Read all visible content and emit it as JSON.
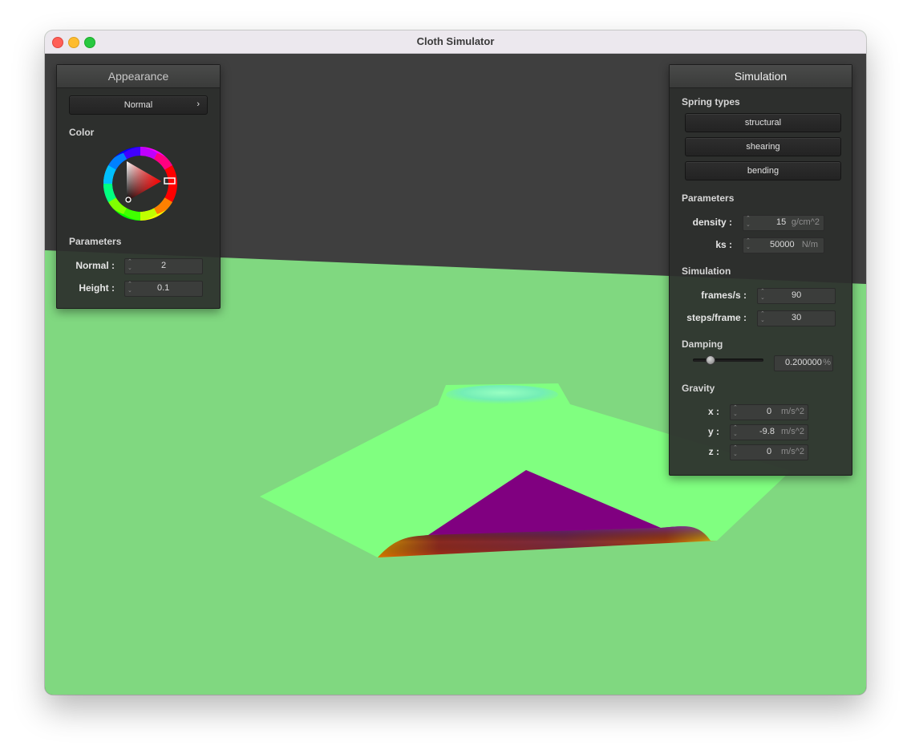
{
  "window": {
    "title": "Cloth Simulator"
  },
  "appearance": {
    "header": "Appearance",
    "shader_dropdown": {
      "value": "Normal",
      "chevron": "›"
    },
    "color_label": "Color",
    "params_label": "Parameters",
    "fields": [
      {
        "label": "Normal :",
        "value": "2"
      },
      {
        "label": "Height :",
        "value": "0.1"
      }
    ]
  },
  "simulation": {
    "header": "Simulation",
    "spring_types_label": "Spring types",
    "spring_buttons": [
      "structural",
      "shearing",
      "bending"
    ],
    "parameters_label": "Parameters",
    "density": {
      "label": "density :",
      "value": "15",
      "unit": "g/cm^2"
    },
    "ks": {
      "label": "ks :",
      "value": "50000",
      "unit": "N/m"
    },
    "simulation_label": "Simulation",
    "frames": {
      "label": "frames/s :",
      "value": "90"
    },
    "steps": {
      "label": "steps/frame :",
      "value": "30"
    },
    "damping_label": "Damping",
    "damping": {
      "value": "0.200000",
      "unit": "%",
      "slider_fraction": 0.2
    },
    "gravity_label": "Gravity",
    "gravity": [
      {
        "label": "x :",
        "value": "0",
        "unit": "m/s^2"
      },
      {
        "label": "y :",
        "value": "-9.8",
        "unit": "m/s^2"
      },
      {
        "label": "z :",
        "value": "0",
        "unit": "m/s^2"
      }
    ]
  },
  "colors": {
    "ground": "#80d880",
    "sky": "#3f3f3f",
    "cloth_light": "#80ff80",
    "cloth_dark": "#800080",
    "picker_selected": "#ff0000"
  },
  "icons": {
    "spinner": "updown-spinner-icon",
    "chevron": "chevron-right-icon"
  }
}
